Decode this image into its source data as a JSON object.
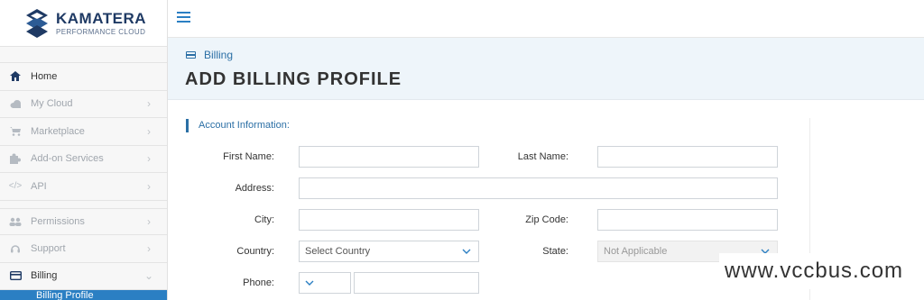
{
  "brand": {
    "name": "KAMATERA",
    "tagline": "PERFORMANCE CLOUD"
  },
  "sidebar": {
    "items": [
      {
        "label": "Home",
        "icon": "home-icon"
      },
      {
        "label": "My Cloud",
        "icon": "cloud-icon"
      },
      {
        "label": "Marketplace",
        "icon": "cart-icon"
      },
      {
        "label": "Add-on Services",
        "icon": "puzzle-icon"
      },
      {
        "label": "API",
        "icon": "code-icon"
      },
      {
        "label": "Permissions",
        "icon": "users-icon"
      },
      {
        "label": "Support",
        "icon": "headset-icon"
      },
      {
        "label": "Billing",
        "icon": "credit-card-icon"
      }
    ],
    "subitem": "Billing Profile"
  },
  "breadcrumb": {
    "label": "Billing"
  },
  "page": {
    "title": "ADD BILLING PROFILE"
  },
  "form": {
    "section": "Account Information:",
    "first_name": {
      "label": "First Name:",
      "value": ""
    },
    "last_name": {
      "label": "Last Name:",
      "value": ""
    },
    "address": {
      "label": "Address:",
      "value": ""
    },
    "city": {
      "label": "City:",
      "value": ""
    },
    "zip": {
      "label": "Zip Code:",
      "value": ""
    },
    "country": {
      "label": "Country:",
      "value": "Select Country"
    },
    "state": {
      "label": "State:",
      "value": "Not Applicable"
    },
    "phone": {
      "label": "Phone:",
      "value": ""
    }
  },
  "watermark": "www.vccbus.com",
  "colors": {
    "accent": "#2b7fc3",
    "brand": "#1f3a64",
    "header_bg": "#eef5fa"
  }
}
